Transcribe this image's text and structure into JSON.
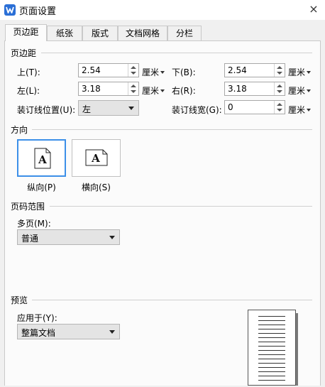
{
  "window": {
    "title": "页面设置",
    "app_icon": "wps-writer-icon",
    "close_glyph": "×"
  },
  "tabs": [
    {
      "label": "页边距",
      "active": true
    },
    {
      "label": "纸张",
      "active": false
    },
    {
      "label": "版式",
      "active": false
    },
    {
      "label": "文档网格",
      "active": false
    },
    {
      "label": "分栏",
      "active": false
    }
  ],
  "margins": {
    "section_title": "页边距",
    "top": {
      "label": "上(T):",
      "value": "2.54",
      "unit": "厘米"
    },
    "bottom": {
      "label": "下(B):",
      "value": "2.54",
      "unit": "厘米"
    },
    "left": {
      "label": "左(L):",
      "value": "3.18",
      "unit": "厘米"
    },
    "right": {
      "label": "右(R):",
      "value": "3.18",
      "unit": "厘米"
    },
    "gutter_position": {
      "label": "装订线位置(U):",
      "value": "左"
    },
    "gutter_width": {
      "label": "装订线宽(G):",
      "value": "0",
      "unit": "厘米"
    }
  },
  "orientation": {
    "section_title": "方向",
    "portrait": {
      "label": "纵向(P)",
      "selected": true,
      "glyph": "A"
    },
    "landscape": {
      "label": "横向(S)",
      "selected": false,
      "glyph": "A"
    }
  },
  "page_range": {
    "section_title": "页码范围",
    "multiple_pages_label": "多页(M):",
    "multiple_pages_value": "普通"
  },
  "preview": {
    "section_title": "预览",
    "apply_to_label": "应用于(Y):",
    "apply_to_value": "整篇文档"
  },
  "colors": {
    "accent": "#3c8fe8",
    "app_icon": "#2b6fd6",
    "panel_bg": "#fbfbfb",
    "window_bg": "#f0f0f0"
  }
}
